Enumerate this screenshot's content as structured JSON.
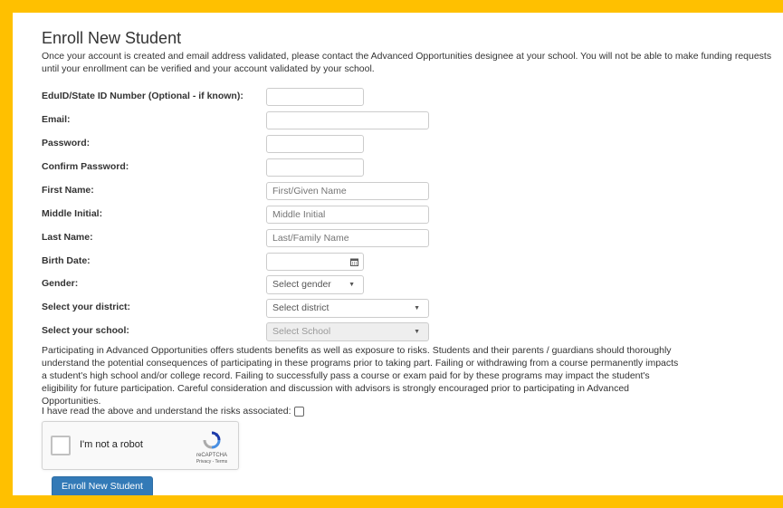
{
  "page": {
    "title": "Enroll New Student",
    "intro": "Once your account is created and email address validated, please contact the Advanced Opportunities designee at your school. You will not be able to make funding requests until your enrollment can be verified and your account validated by your school."
  },
  "form": {
    "eduid": {
      "label": "EduID/State ID Number (Optional - if known):",
      "value": ""
    },
    "email": {
      "label": "Email:",
      "value": ""
    },
    "password": {
      "label": "Password:",
      "value": ""
    },
    "confirm_password": {
      "label": "Confirm Password:",
      "value": ""
    },
    "first_name": {
      "label": "First Name:",
      "placeholder": "First/Given Name"
    },
    "middle_initial": {
      "label": "Middle Initial:",
      "placeholder": "Middle Initial"
    },
    "last_name": {
      "label": "Last Name:",
      "placeholder": "Last/Family Name"
    },
    "birth_date": {
      "label": "Birth Date:",
      "value": "",
      "icon": "calendar-icon"
    },
    "gender": {
      "label": "Gender:",
      "selected": "Select gender"
    },
    "district": {
      "label": "Select your district:",
      "selected": "Select district"
    },
    "school": {
      "label": "Select your school:",
      "selected": "Select School",
      "disabled": true
    }
  },
  "disclaimer": "Participating in Advanced Opportunities offers students benefits as well as exposure to risks. Students and their parents / guardians should thoroughly understand the potential consequences of participating in these programs prior to taking part. Failing or withdrawing from a course permanently impacts a student's high school and/or college record. Failing to successfully pass a course or exam paid for by these programs may impact the student's eligibility for future participation. Careful consideration and discussion with advisors is strongly encouraged prior to participating in Advanced Opportunities.",
  "acknowledge": {
    "label": "I have read the above and understand the risks associated:",
    "checked": false
  },
  "captcha": {
    "label": "I'm not a robot",
    "brand": "reCAPTCHA",
    "terms": "Privacy - Terms"
  },
  "submit": {
    "label": "Enroll New Student"
  },
  "colors": {
    "frame": "#ffc000",
    "primary": "#337ab7"
  }
}
